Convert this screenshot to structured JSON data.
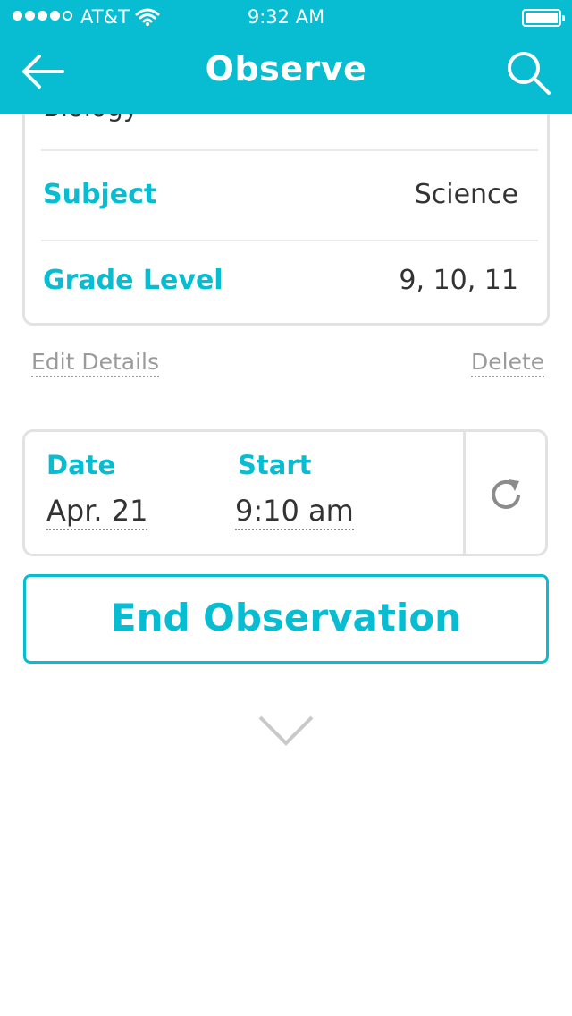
{
  "status_bar": {
    "carrier": "AT&T",
    "time": "9:32 AM",
    "signal_bars_filled": 4,
    "signal_bars_total": 5,
    "battery_level": 1.0
  },
  "nav": {
    "title": "Observe",
    "back_icon": "back-arrow-icon",
    "search_icon": "search-icon",
    "color": "#08bdd1"
  },
  "details": {
    "cut_off_value": "Biology",
    "rows": [
      {
        "label": "Subject",
        "value": "Science"
      },
      {
        "label": "Grade Level",
        "value": "9, 10, 11"
      }
    ],
    "edit_label": "Edit Details",
    "delete_label": "Delete"
  },
  "observation": {
    "date_label": "Date",
    "date_value": "Apr. 21",
    "start_label": "Start",
    "start_value": "9:10 am",
    "refresh_icon": "refresh-icon"
  },
  "end_button_label": "End Observation",
  "expand_icon": "chevron-down-icon"
}
